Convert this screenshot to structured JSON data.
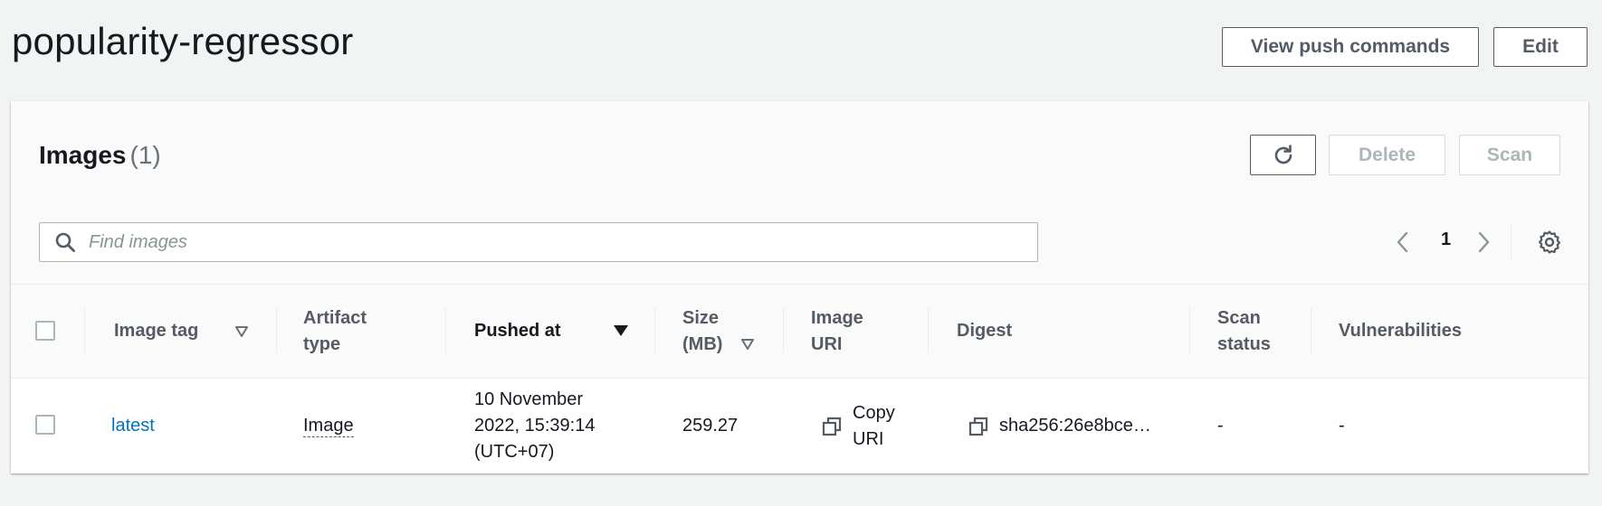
{
  "header": {
    "title": "popularity-regressor",
    "view_push_label": "View push commands",
    "edit_label": "Edit"
  },
  "images_panel": {
    "title": "Images",
    "count": "(1)",
    "delete_label": "Delete",
    "scan_label": "Scan",
    "search": {
      "placeholder": "Find images",
      "value": ""
    },
    "pagination": {
      "current_page": "1"
    }
  },
  "table": {
    "columns": {
      "image_tag": "Image tag",
      "artifact_type": "Artifact type",
      "pushed_at": "Pushed at",
      "size": "Size (MB)",
      "image_uri": "Image URI",
      "digest": "Digest",
      "scan_status": "Scan status",
      "vulnerabilities": "Vulnerabilities"
    },
    "rows": [
      {
        "image_tag": "latest",
        "artifact_type": "Image",
        "pushed_at": "10 November 2022, 15:39:14 (UTC+07)",
        "size": "259.27",
        "image_uri": "Copy URI",
        "digest": "sha256:26e8bce…",
        "scan_status": "-",
        "vulnerabilities": "-"
      }
    ]
  },
  "colors": {
    "page_bg": "#f2f3f3",
    "link": "#0073bb",
    "text": "#16191f",
    "muted": "#545b64",
    "disabled": "#aab7b8"
  }
}
